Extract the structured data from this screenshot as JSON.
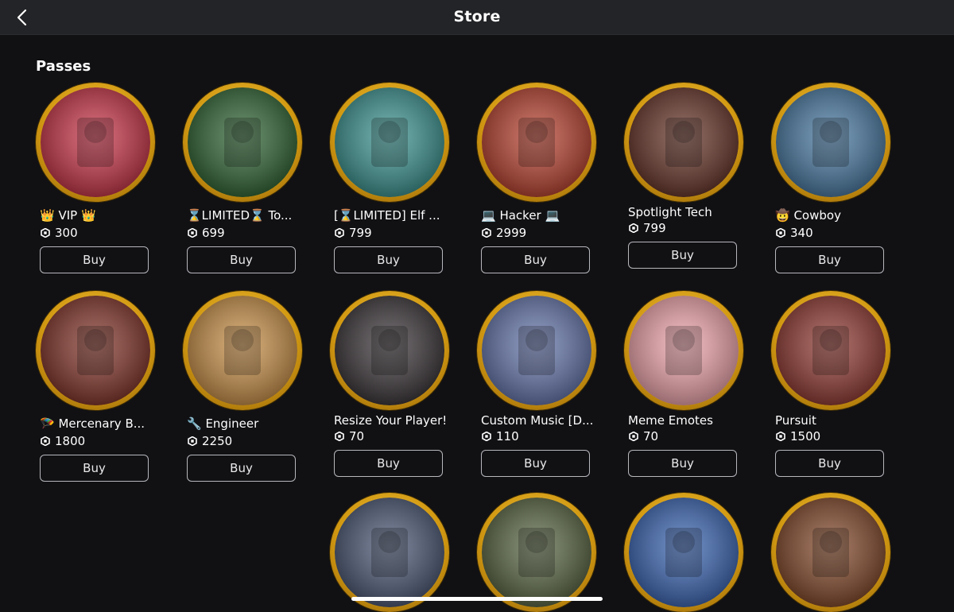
{
  "header": {
    "title": "Store"
  },
  "section": {
    "title": "Passes"
  },
  "buy_label": "Buy",
  "accent": "#e0a313",
  "passes": [
    {
      "name": "👑 VIP 👑",
      "price": "300",
      "art": "#c9243a"
    },
    {
      "name": "⌛LIMITED⌛ To...",
      "price": "699",
      "art": "#1f5a24"
    },
    {
      "name": "[⌛LIMITED] Elf ...",
      "price": "799",
      "art": "#2c8d8a"
    },
    {
      "name": "💻 Hacker 💻",
      "price": "2999",
      "art": "#b7331f"
    },
    {
      "name": "Spotlight Tech",
      "price": "799",
      "art": "#5b2417"
    },
    {
      "name": "🤠 Cowboy",
      "price": "340",
      "art": "#3a6f9c"
    },
    {
      "name": "🪂 Mercenary B...",
      "price": "1800",
      "art": "#7a2418"
    },
    {
      "name": "🔧 Engineer",
      "price": "2250",
      "art": "#c98a3a"
    },
    {
      "name": "Resize Your Player!",
      "price": "70",
      "art": "#2a2428"
    },
    {
      "name": "Custom Music [D...",
      "price": "110",
      "art": "#5a6ca8"
    },
    {
      "name": "Meme Emotes",
      "price": "70",
      "art": "#f2a0a8"
    },
    {
      "name": "Pursuit",
      "price": "1500",
      "art": "#8a2a22"
    },
    {
      "art": "#3c4a6a"
    },
    {
      "art": "#4c5a34"
    },
    {
      "art": "#2b5ab0"
    },
    {
      "art": "#7a3a18"
    }
  ]
}
